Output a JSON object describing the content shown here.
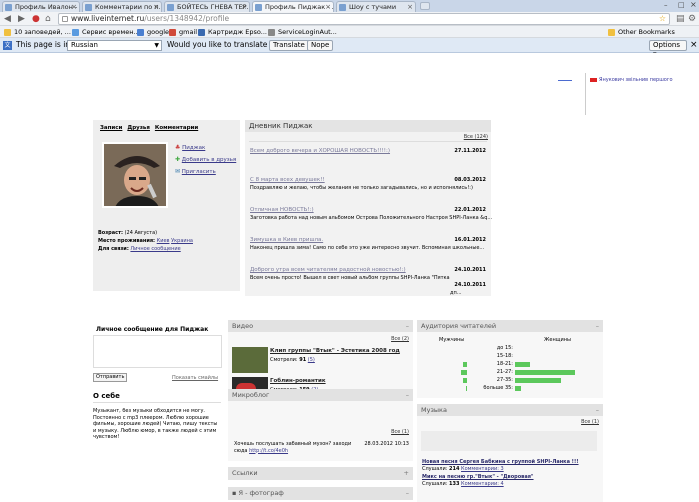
{
  "browser": {
    "tabs": [
      {
        "label": "Профиль Ивалон - П..."
      },
      {
        "label": "Комментарии по п..."
      },
      {
        "label": "БОЙТЕСЬ ГНЕВА ТЕР..."
      },
      {
        "label": "Профиль Пиджак - ..."
      },
      {
        "label": "Шоу с тучами"
      }
    ],
    "url_host": "www.liveinternet.ru",
    "url_path": "/users/1348942/profile",
    "bookmarks": [
      {
        "label": "10 заповедей, ..."
      },
      {
        "label": "Сервис времен..."
      },
      {
        "label": "google"
      },
      {
        "label": "gmail"
      },
      {
        "label": "Картридж Epso..."
      },
      {
        "label": "ServiceLoginAut..."
      }
    ],
    "other_bookmarks": "Other Bookmarks",
    "translate": {
      "prefix": "This page is in",
      "language": "Russian",
      "question": "Would you like to translate it?",
      "translate_btn": "Translate",
      "nope_btn": "Nope",
      "options_btn": "Options"
    }
  },
  "ad": {
    "text": "Янукович звільнив першого"
  },
  "profile": {
    "nav": [
      "Записи",
      "Друзья",
      "Комментарии"
    ],
    "actions": [
      "Пиджак",
      "Добавить в друзья",
      "Пригласить"
    ],
    "age_label": "Возраст:",
    "age_value": "(24 Августа)",
    "residence_label": "Место проживания:",
    "residence_city": "Киев",
    "residence_country": "Украина",
    "contact_label": "Для связи:",
    "contact_value": "Личное сообщение"
  },
  "diary": {
    "title": "Дневник Пиджак",
    "all_link": "Все (124)",
    "entries": [
      {
        "title": "Всем доброго вечера и ХОРОШАЯ НОВОСТЬ!!!!:)",
        "date": "27.11.2012",
        "text": ""
      },
      {
        "title": "С 8 марта всех девушек!!",
        "date": "08.03.2012",
        "text": "Поздравляю и желаю, чтобы желания не только загадывались, но и исполнялись!:)"
      },
      {
        "title": "Отличная НОВОСТЬ!:)",
        "date": "22.01.2012",
        "text": "Заготовка работа над новым альбомом Острова Положительного Настроя SHPI-Ланка &q..."
      },
      {
        "title": "Зимушка в Киев пришла.",
        "date": "16.01.2012",
        "text": "Наконец пришла зима! Само по себе это уже интересно звучит. Вспоминая школьные..."
      },
      {
        "title": "Доброго утра всем читателям радостной новостью!:)",
        "date": "24.10.2011",
        "text": "Всем очень просто! Вышел в свет новый альбом группы SHPI-Ланка \"Пятка надежды\"..."
      },
      {
        "title": "",
        "date": "24.10.2011",
        "text": "дп..."
      }
    ]
  },
  "message": {
    "title": "Личное сообщение для Пиджак",
    "send_btn": "Отправить",
    "smileys_link": "Показать смайлы"
  },
  "about": {
    "title": "О себе",
    "text": "Музыкант, без музыки обходится не могу. Постоянно с mp3 плеером. Люблю хорошие фильмы, хорошие людей) Читаю, пишу тексты и музыку. Люблю юмор, в также людей с этим чувством!"
  },
  "video": {
    "title": "Видео",
    "all_link": "Все (2)",
    "items": [
      {
        "title": "Клип группы \"Втык\" - Эстетика 2008 год",
        "views_label": "Смотрели:",
        "views": "91",
        "comments": "(5)"
      },
      {
        "title": "Гоблин-романтик",
        "views_label": "Смотрели:",
        "views": "159",
        "comments": "(2)"
      }
    ]
  },
  "microblog": {
    "title": "Микроблог",
    "all_link": "Все (1)",
    "text": "Хочешь послушать забавный музон? заходи сюда",
    "link": "http://t.co/4e0h",
    "date": "28.03.2012 10:13"
  },
  "links": {
    "title": "Ссылки"
  },
  "photo": {
    "title": "Я - фотограф"
  },
  "audience": {
    "title": "Аудитория читателей",
    "men_label": "Мужчины",
    "women_label": "Женщины",
    "age_groups": [
      "до 15:",
      "15-18:",
      "18-21:",
      "21-27:",
      "27-35:",
      "больше 35:"
    ],
    "men": [
      0,
      0,
      0.05,
      0.08,
      0.06,
      0.02
    ],
    "women": [
      0,
      0,
      0.22,
      0.85,
      0.66,
      0.08
    ]
  },
  "music": {
    "title": "Музыка",
    "all_link": "Все (1)",
    "items": [
      {
        "title": "Новая песня Сергея Бабкина с группой SHPI-Ланка !!!",
        "listen_label": "Слушали:",
        "count": "214",
        "comments": "Комментарии: 3"
      },
      {
        "title": "Микс на песню гр.\"Втык\" - \"Дворовая\"",
        "listen_label": "Слушали:",
        "count": "133",
        "comments": "Комментарии: 4"
      }
    ]
  },
  "colors": {
    "accent_green": "#5cc85c",
    "link": "#3a3a8a",
    "panel": "#f0f0f0",
    "header": "#e2e2e2"
  }
}
